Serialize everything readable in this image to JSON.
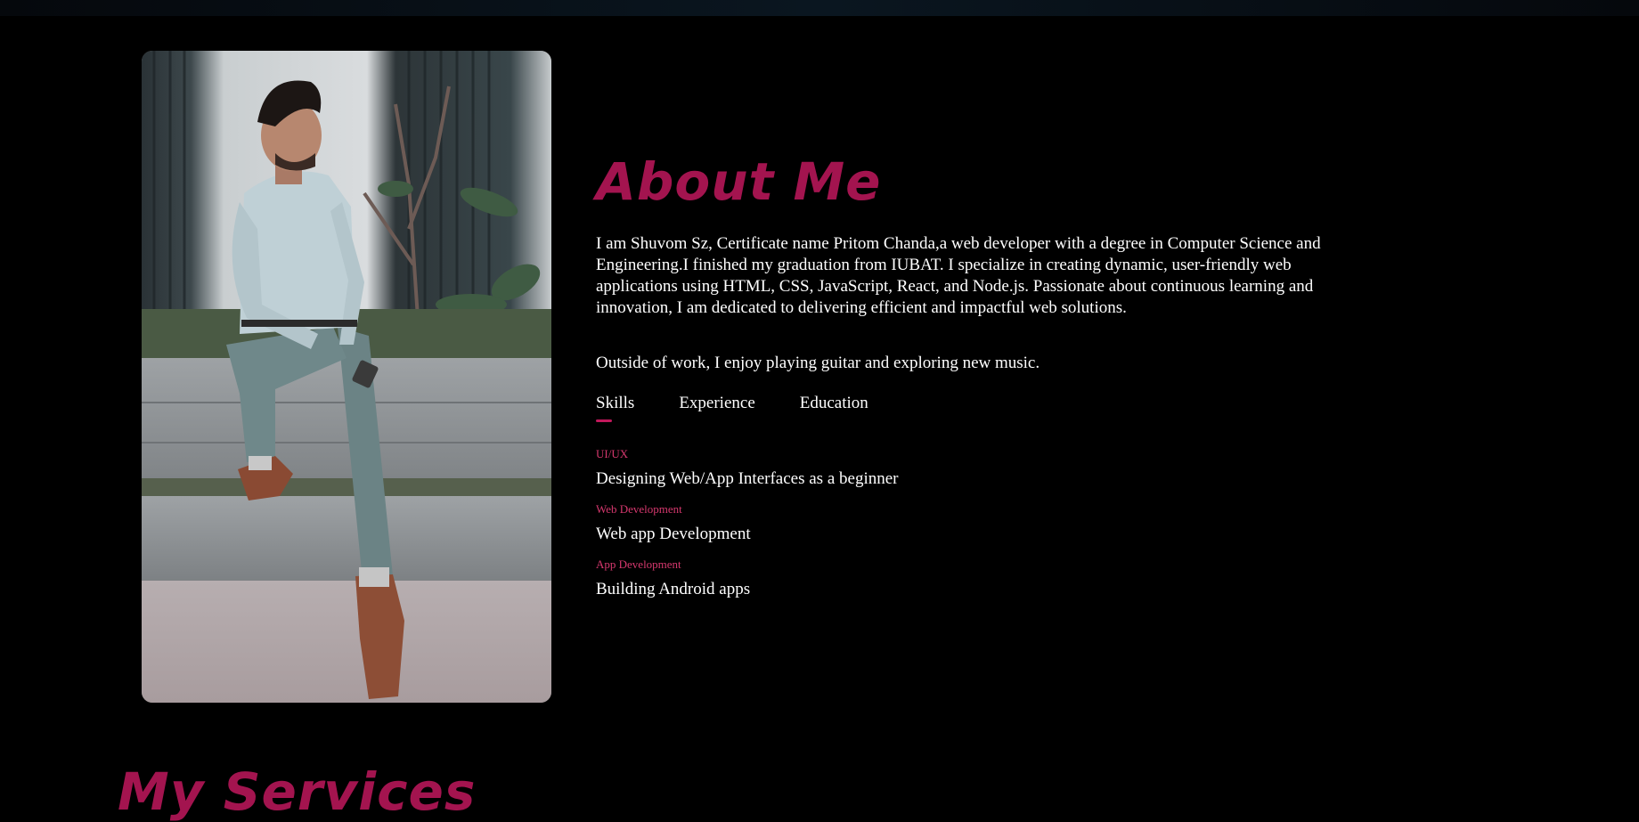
{
  "about": {
    "title": "About Me",
    "bio": "I am Shuvom Sz, Certificate name Pritom Chanda,a web developer with a degree in Computer Science and Engineering.I finished my graduation from IUBAT. I specialize in creating dynamic, user-friendly web applications using HTML, CSS, JavaScript, React, and Node.js. Passionate about continuous learning and innovation, I am dedicated to delivering efficient and impactful web solutions.",
    "hobby": "Outside of work, I enjoy playing guitar and exploring new music."
  },
  "tabs": [
    {
      "label": "Skills",
      "active": true
    },
    {
      "label": "Experience",
      "active": false
    },
    {
      "label": "Education",
      "active": false
    }
  ],
  "skills": [
    {
      "category": "UI/UX",
      "description": "Designing Web/App Interfaces as a beginner"
    },
    {
      "category": "Web Development",
      "description": "Web app Development"
    },
    {
      "category": "App Development",
      "description": "Building Android apps"
    }
  ],
  "services": {
    "title": "My Services"
  },
  "colors": {
    "accent": "#a3144f",
    "accent_light": "#d6386e",
    "background": "#000000",
    "text": "#ffffff"
  }
}
